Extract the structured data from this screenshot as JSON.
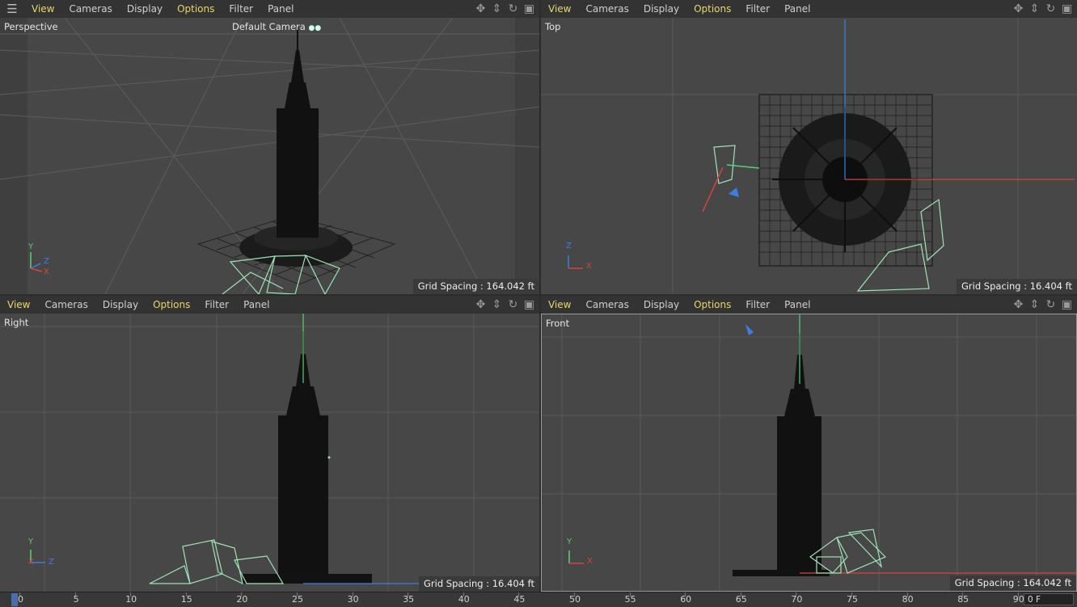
{
  "menu": {
    "items": [
      "View",
      "Cameras",
      "Display",
      "Options",
      "Filter",
      "Panel"
    ],
    "active_items": [
      "View",
      "Options"
    ]
  },
  "nav_icons": [
    "move-icon",
    "zoom-icon",
    "rotate-icon",
    "maximize-icon"
  ],
  "viewports": {
    "perspective": {
      "label": "Perspective",
      "camera": "Default Camera",
      "grid_spacing": "Grid Spacing : 164.042 ft",
      "axes": [
        "Y",
        "Z",
        "X"
      ]
    },
    "top": {
      "label": "Top",
      "grid_spacing": "Grid Spacing : 16.404 ft",
      "axes": [
        "Z",
        "X"
      ]
    },
    "right": {
      "label": "Right",
      "grid_spacing": "Grid Spacing : 16.404 ft",
      "axes": [
        "Y",
        "X",
        "Z"
      ]
    },
    "front": {
      "label": "Front",
      "grid_spacing": "Grid Spacing : 164.042 ft",
      "axes": [
        "Y",
        "X"
      ]
    }
  },
  "timeline": {
    "ticks": [
      "0",
      "5",
      "10",
      "15",
      "20",
      "25",
      "30",
      "35",
      "40",
      "45",
      "50",
      "55",
      "60",
      "65",
      "70",
      "75",
      "80",
      "85",
      "90"
    ],
    "current_frame": "0 F"
  },
  "colors": {
    "accent_menu": "#e8d76a",
    "axis_x": "#d9443a",
    "axis_y": "#58d07a",
    "axis_z": "#3c7fe0",
    "wireframe_selected": "#9fe3b8",
    "viewport_bg": "#474747"
  }
}
